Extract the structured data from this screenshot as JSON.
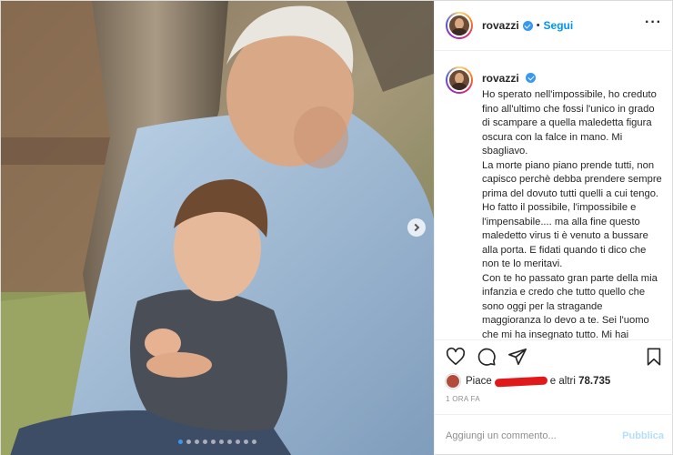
{
  "post": {
    "header": {
      "username": "rovazzi",
      "separator": "•",
      "follow_label": "Segui",
      "more_icon": "more-horizontal-icon",
      "more_label": "···"
    },
    "caption": {
      "username": "rovazzi",
      "text": "Ho sperato nell'impossibile, ho creduto fino all'ultimo che fossi l'unico in grado di scampare a quella maledetta figura oscura con la falce in mano. Mi sbagliavo.\nLa morte piano piano prende tutti, non capisco perchè debba prendere sempre prima del dovuto tutti quelli a cui tengo.\nHo fatto il possibile, l'impossibile e l'impensabile.... ma alla fine questo maledetto virus ti è venuto a bussare alla porta. E fidati quando ti dico che non te lo meritavi.\nCon te ho passato gran parte della mia infanzia e credo che tutto quello che sono oggi per la stragande maggioranza lo devo a te. Sei l'uomo che mi ha insegnato tutto. Mi hai"
    },
    "actions": {
      "like_icon": "heart-icon",
      "comment_icon": "comment-icon",
      "share_icon": "share-icon",
      "save_icon": "bookmark-icon"
    },
    "likes": {
      "prefix": "Piace",
      "suffix": "e altri",
      "count": "78.735"
    },
    "timestamp": "1 ORA FA",
    "comment": {
      "placeholder": "Aggiungi un commento...",
      "publish_label": "Pubblica"
    },
    "carousel": {
      "slide_count": 10,
      "active_index": 0
    },
    "colors": {
      "link_blue": "#0095f6",
      "publish_disabled": "#b2dffc",
      "verified_blue": "#3897f0",
      "redaction_red": "#e0191b"
    }
  }
}
